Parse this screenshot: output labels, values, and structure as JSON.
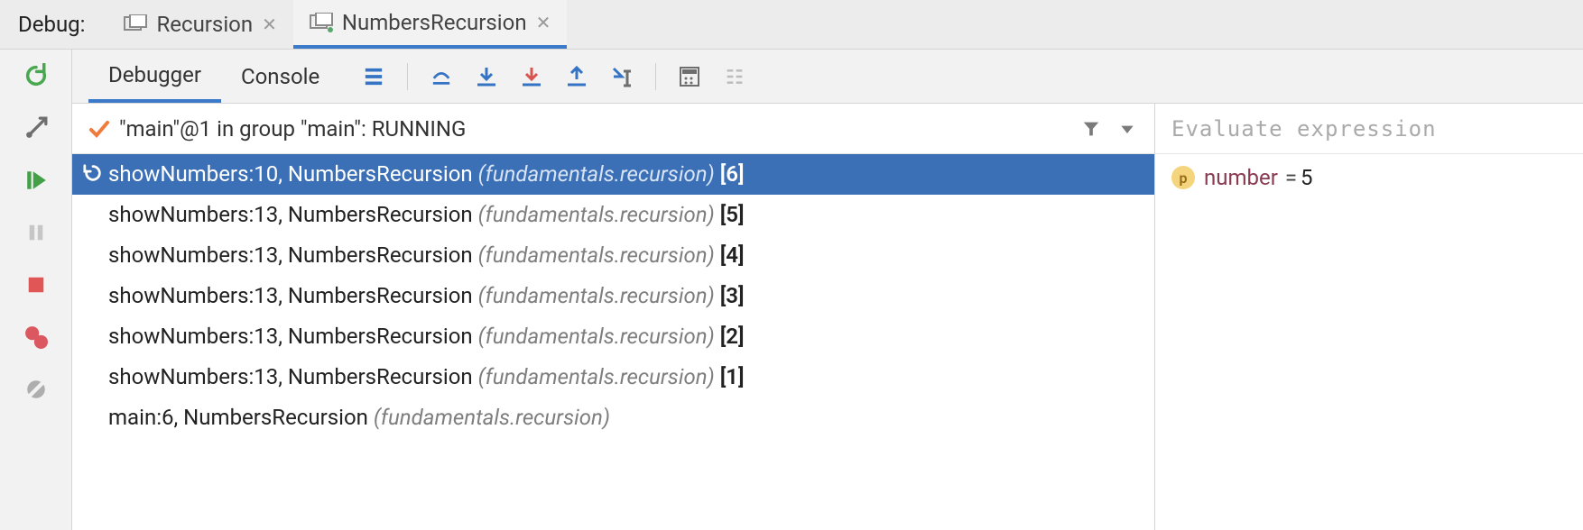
{
  "header": {
    "label": "Debug:",
    "tabs": [
      {
        "title": "Recursion",
        "active": false
      },
      {
        "title": "NumbersRecursion",
        "active": true
      }
    ]
  },
  "debuggerToolbar": {
    "tabs": [
      {
        "label": "Debugger",
        "active": true
      },
      {
        "label": "Console",
        "active": false
      }
    ]
  },
  "threadHeader": {
    "text": "\"main\"@1 in group \"main\": RUNNING"
  },
  "frames": [
    {
      "method": "showNumbers:10, NumbersRecursion",
      "pkg": "(fundamentals.recursion)",
      "idx": "[6]",
      "selected": true,
      "dropIcon": true
    },
    {
      "method": "showNumbers:13, NumbersRecursion",
      "pkg": "(fundamentals.recursion)",
      "idx": "[5]",
      "selected": false
    },
    {
      "method": "showNumbers:13, NumbersRecursion",
      "pkg": "(fundamentals.recursion)",
      "idx": "[4]",
      "selected": false
    },
    {
      "method": "showNumbers:13, NumbersRecursion",
      "pkg": "(fundamentals.recursion)",
      "idx": "[3]",
      "selected": false
    },
    {
      "method": "showNumbers:13, NumbersRecursion",
      "pkg": "(fundamentals.recursion)",
      "idx": "[2]",
      "selected": false
    },
    {
      "method": "showNumbers:13, NumbersRecursion",
      "pkg": "(fundamentals.recursion)",
      "idx": "[1]",
      "selected": false
    },
    {
      "method": "main:6, NumbersRecursion",
      "pkg": "(fundamentals.recursion)",
      "idx": "",
      "selected": false
    }
  ],
  "evalPlaceholder": "Evaluate expression",
  "variables": [
    {
      "badge": "p",
      "name": "number",
      "value": "5"
    }
  ]
}
